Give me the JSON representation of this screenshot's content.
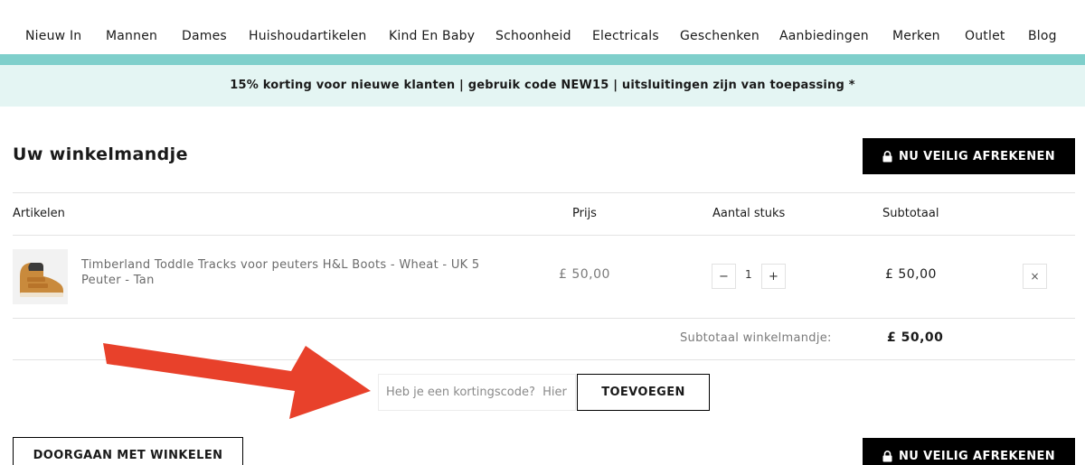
{
  "nav": {
    "items": [
      "Nieuw In",
      "Mannen",
      "Dames",
      "Huishoudartikelen",
      "Kind En Baby",
      "Schoonheid",
      "Electricals",
      "Geschenken",
      "Aanbiedingen",
      "Merken",
      "Outlet",
      "Blog"
    ]
  },
  "promo": {
    "text": "15% korting voor nieuwe klanten | gebruik code NEW15 | uitsluitingen zijn van toepassing *"
  },
  "cart": {
    "title": "Uw winkelmandje",
    "checkout_label": "NU VEILIG AFREKENEN",
    "columns": {
      "items": "Artikelen",
      "price": "Prijs",
      "qty": "Aantal stuks",
      "subtotal": "Subtotaal"
    },
    "line_items": [
      {
        "name": "Timberland Toddle Tracks voor peuters H&L Boots - Wheat - UK 5 Peuter - Tan",
        "price": "£ 50,00",
        "quantity": "1",
        "subtotal": "£ 50,00",
        "minus": "−",
        "plus": "+",
        "remove": "×"
      }
    ],
    "cart_subtotal_label": "Subtotaal winkelmandje:",
    "cart_subtotal_value": "£ 50,00",
    "coupon_placeholder": "Heb je een kortingscode?  Hier",
    "coupon_button": "TOEVOEGEN",
    "continue_label": "DOORGAAN MET WINKELEN"
  },
  "colors": {
    "accent_bar": "#7fcfcb",
    "promo_bg": "#e4f5f3",
    "annotation_arrow": "#e8412b"
  },
  "icons": {
    "lock": "lock-icon",
    "remove": "close-icon",
    "annotation": "arrow-annotation"
  }
}
